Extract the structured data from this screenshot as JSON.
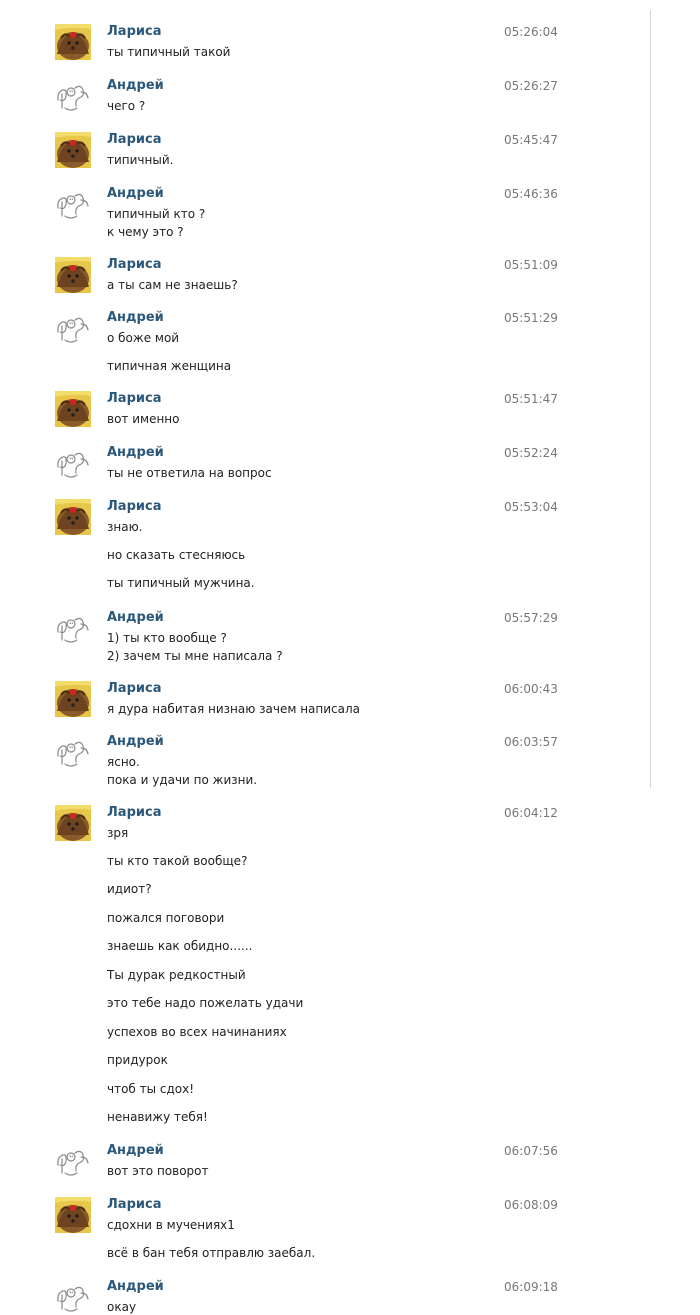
{
  "messages": [
    {
      "author": "Лариса",
      "avatar": "yorkie-dog-photo",
      "time": "05:26:04",
      "lines": [
        "ты типичный такой"
      ]
    },
    {
      "author": "Андрей",
      "avatar": "sketch-doodle-avatar",
      "time": "05:26:27",
      "lines": [
        "чего ?"
      ]
    },
    {
      "author": "Лариса",
      "avatar": "yorkie-dog-photo",
      "time": "05:45:47",
      "lines": [
        "типичный."
      ]
    },
    {
      "author": "Андрей",
      "avatar": "sketch-doodle-avatar",
      "time": "05:46:36",
      "lines": [
        "типичный кто ?",
        "к чему это ?"
      ]
    },
    {
      "author": "Лариса",
      "avatar": "yorkie-dog-photo",
      "time": "05:51:09",
      "lines": [
        "а ты сам не знаешь?"
      ]
    },
    {
      "author": "Андрей",
      "avatar": "sketch-doodle-avatar",
      "time": "05:51:29",
      "lines": [
        "о боже мой",
        "типичная женщина"
      ]
    },
    {
      "author": "Лариса",
      "avatar": "yorkie-dog-photo",
      "time": "05:51:47",
      "lines": [
        "вот именно"
      ]
    },
    {
      "author": "Андрей",
      "avatar": "sketch-doodle-avatar",
      "time": "05:52:24",
      "lines": [
        "ты не ответила на вопрос"
      ]
    },
    {
      "author": "Лариса",
      "avatar": "yorkie-dog-photo",
      "time": "05:53:04",
      "lines": [
        "знаю.",
        "но сказать стесняюсь",
        "ты типичный мужчина."
      ]
    },
    {
      "author": "Андрей",
      "avatar": "sketch-doodle-avatar",
      "time": "05:57:29",
      "lines": [
        "1) ты кто вообще ?",
        "2) зачем ты мне написала ?"
      ]
    },
    {
      "author": "Лариса",
      "avatar": "yorkie-dog-photo",
      "time": "06:00:43",
      "lines": [
        "я дура набитая низнаю зачем написала"
      ]
    },
    {
      "author": "Андрей",
      "avatar": "sketch-doodle-avatar",
      "time": "06:03:57",
      "lines": [
        "ясно.",
        "пока и удачи по жизни."
      ]
    },
    {
      "author": "Лариса",
      "avatar": "yorkie-dog-photo",
      "time": "06:04:12",
      "lines": [
        "зря",
        "ты кто такой вообще?",
        "идиот?",
        "пожался поговори",
        "знаешь как обидно......",
        "Ты дурак редкостный",
        "это тебе надо пожелать удачи",
        "успехов во всех начинаниях",
        "придурок",
        "чтоб ты сдох!",
        "ненавижу тебя!"
      ]
    },
    {
      "author": "Андрей",
      "avatar": "sketch-doodle-avatar",
      "time": "06:07:56",
      "lines": [
        "вот это поворот"
      ]
    },
    {
      "author": "Лариса",
      "avatar": "yorkie-dog-photo",
      "time": "06:08:09",
      "lines": [
        "сдохни в мучениях1",
        "всё в бан тебя отправлю заебал."
      ]
    },
    {
      "author": "Андрей",
      "avatar": "sketch-doodle-avatar",
      "time": "06:09:18",
      "lines": [
        "окау"
      ]
    }
  ]
}
